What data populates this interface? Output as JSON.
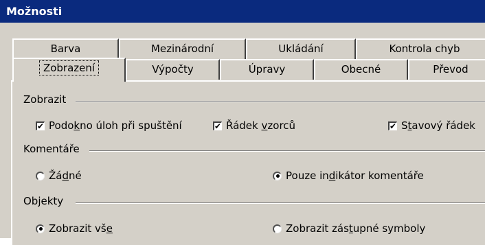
{
  "window": {
    "title": "Možnosti"
  },
  "tabs_row1": [
    "Barva",
    "Mezinárodní",
    "Ukládání",
    "Kontrola chyb"
  ],
  "tabs_row2": [
    "Zobrazení",
    "Výpočty",
    "Úpravy",
    "Obecné",
    "Převod"
  ],
  "active_tab": "Zobrazení",
  "zobrazit": {
    "label": "Zobrazit",
    "options": [
      {
        "pre": "Podo",
        "acc": "k",
        "post": "no úloh při spuštění",
        "checked": true
      },
      {
        "pre": "Řádek ",
        "acc": "v",
        "post": "zorců",
        "checked": true
      },
      {
        "pre": "S",
        "acc": "t",
        "post": "avový řádek",
        "checked": true
      }
    ]
  },
  "komentare": {
    "label": "Komentáře",
    "options": [
      {
        "pre": "Žá",
        "acc": "d",
        "post": "né",
        "selected": false
      },
      {
        "pre": "Pouze in",
        "acc": "d",
        "post": "ikátor komentáře",
        "selected": true
      }
    ]
  },
  "objekty": {
    "label": "Objekty",
    "options": [
      {
        "pre": "Zobrazit vš",
        "acc": "e",
        "post": "",
        "selected": true
      },
      {
        "pre": "Zobrazit zás",
        "acc": "t",
        "post": "upné symboly",
        "selected": false
      }
    ]
  }
}
